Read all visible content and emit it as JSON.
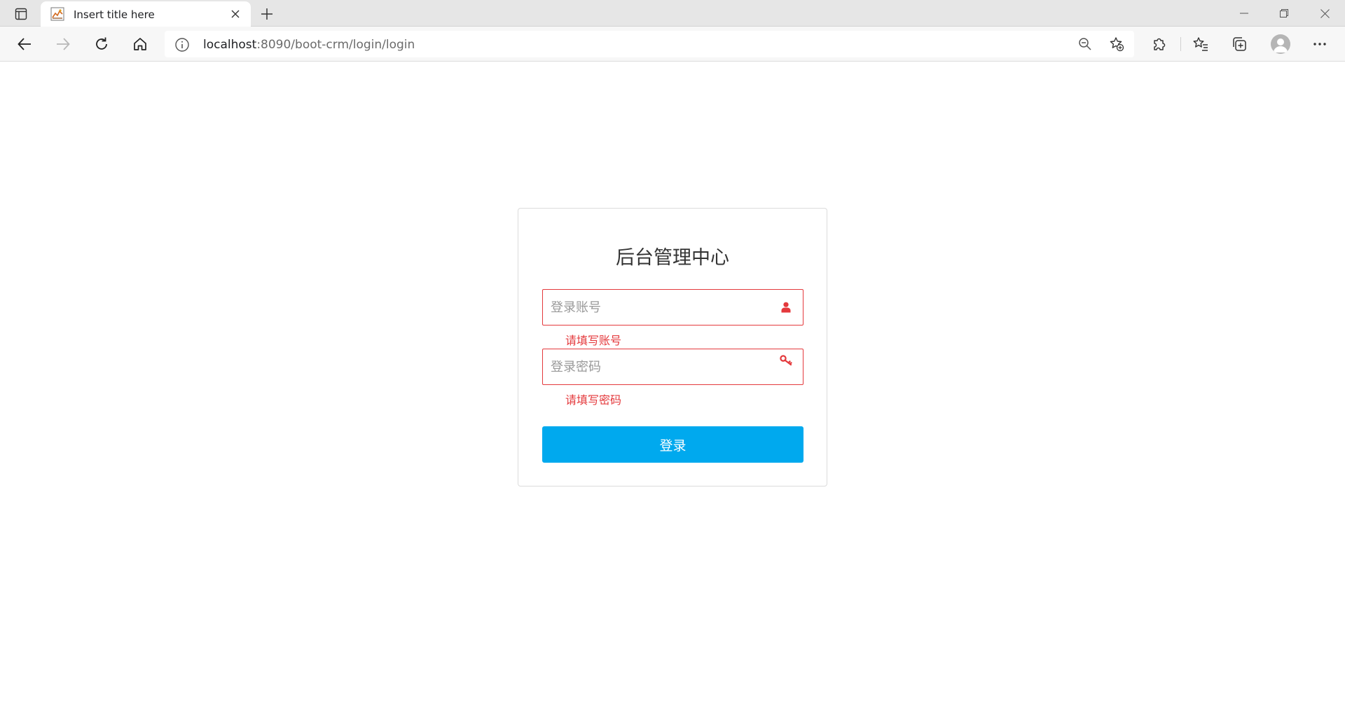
{
  "browser": {
    "tab": {
      "title": "Insert title here"
    },
    "address": {
      "host": "localhost",
      "rest": ":8090/boot-crm/login/login"
    }
  },
  "login": {
    "title": "后台管理中心",
    "username": {
      "placeholder": "登录账号",
      "value": "",
      "error": "请填写账号",
      "icon": "user-icon"
    },
    "password": {
      "placeholder": "登录密码",
      "value": "",
      "error": "请填写密码",
      "icon": "key-icon"
    },
    "submit_label": "登录"
  },
  "colors": {
    "accent": "#00a9ee",
    "error": "#e4393c",
    "title_text": "#333333"
  }
}
